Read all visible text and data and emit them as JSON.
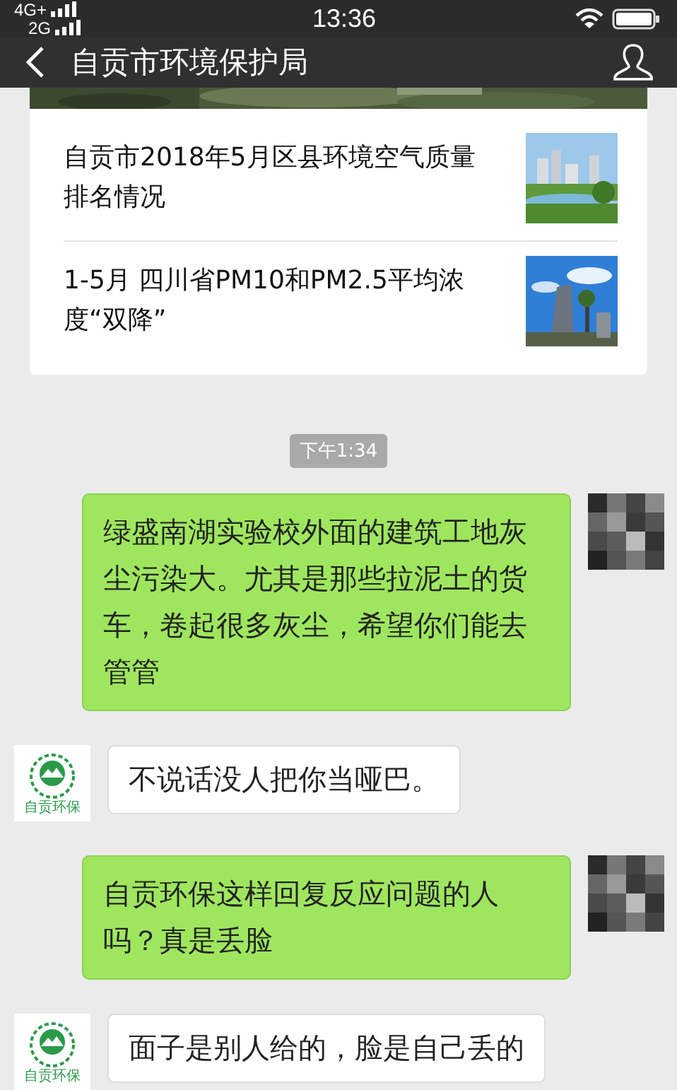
{
  "status_bar": {
    "network_1": "4G+",
    "network_2": "2G",
    "time": "13:36"
  },
  "title_bar": {
    "title": "自贡市环境保护局"
  },
  "article_card": {
    "kind": "picture",
    "articles": [
      {
        "title": "自贡市2018年5月区县环境空气质量排名情况",
        "kind": "picture"
      },
      {
        "title": "1-5月 四川省PM10和PM2.5平均浓度“双降”",
        "kind": "picture"
      }
    ]
  },
  "timestamp": "下午1:34",
  "messages": [
    {
      "kind": "outgoing",
      "text": "绿盛南湖实验校外面的建筑工地灰尘污染大。尤其是那些拉泥土的货车，卷起很多灰尘，希望你们能去管管"
    },
    {
      "kind": "incoming",
      "avatar_label": "自贡环保",
      "text": "不说话没人把你当哑巴。"
    },
    {
      "kind": "outgoing",
      "text": "自贡环保这样回复反应问题的人吗？真是丢脸"
    },
    {
      "kind": "incoming",
      "avatar_label": "自贡环保",
      "text": "面子是别人给的，脸是自己丢的"
    }
  ]
}
